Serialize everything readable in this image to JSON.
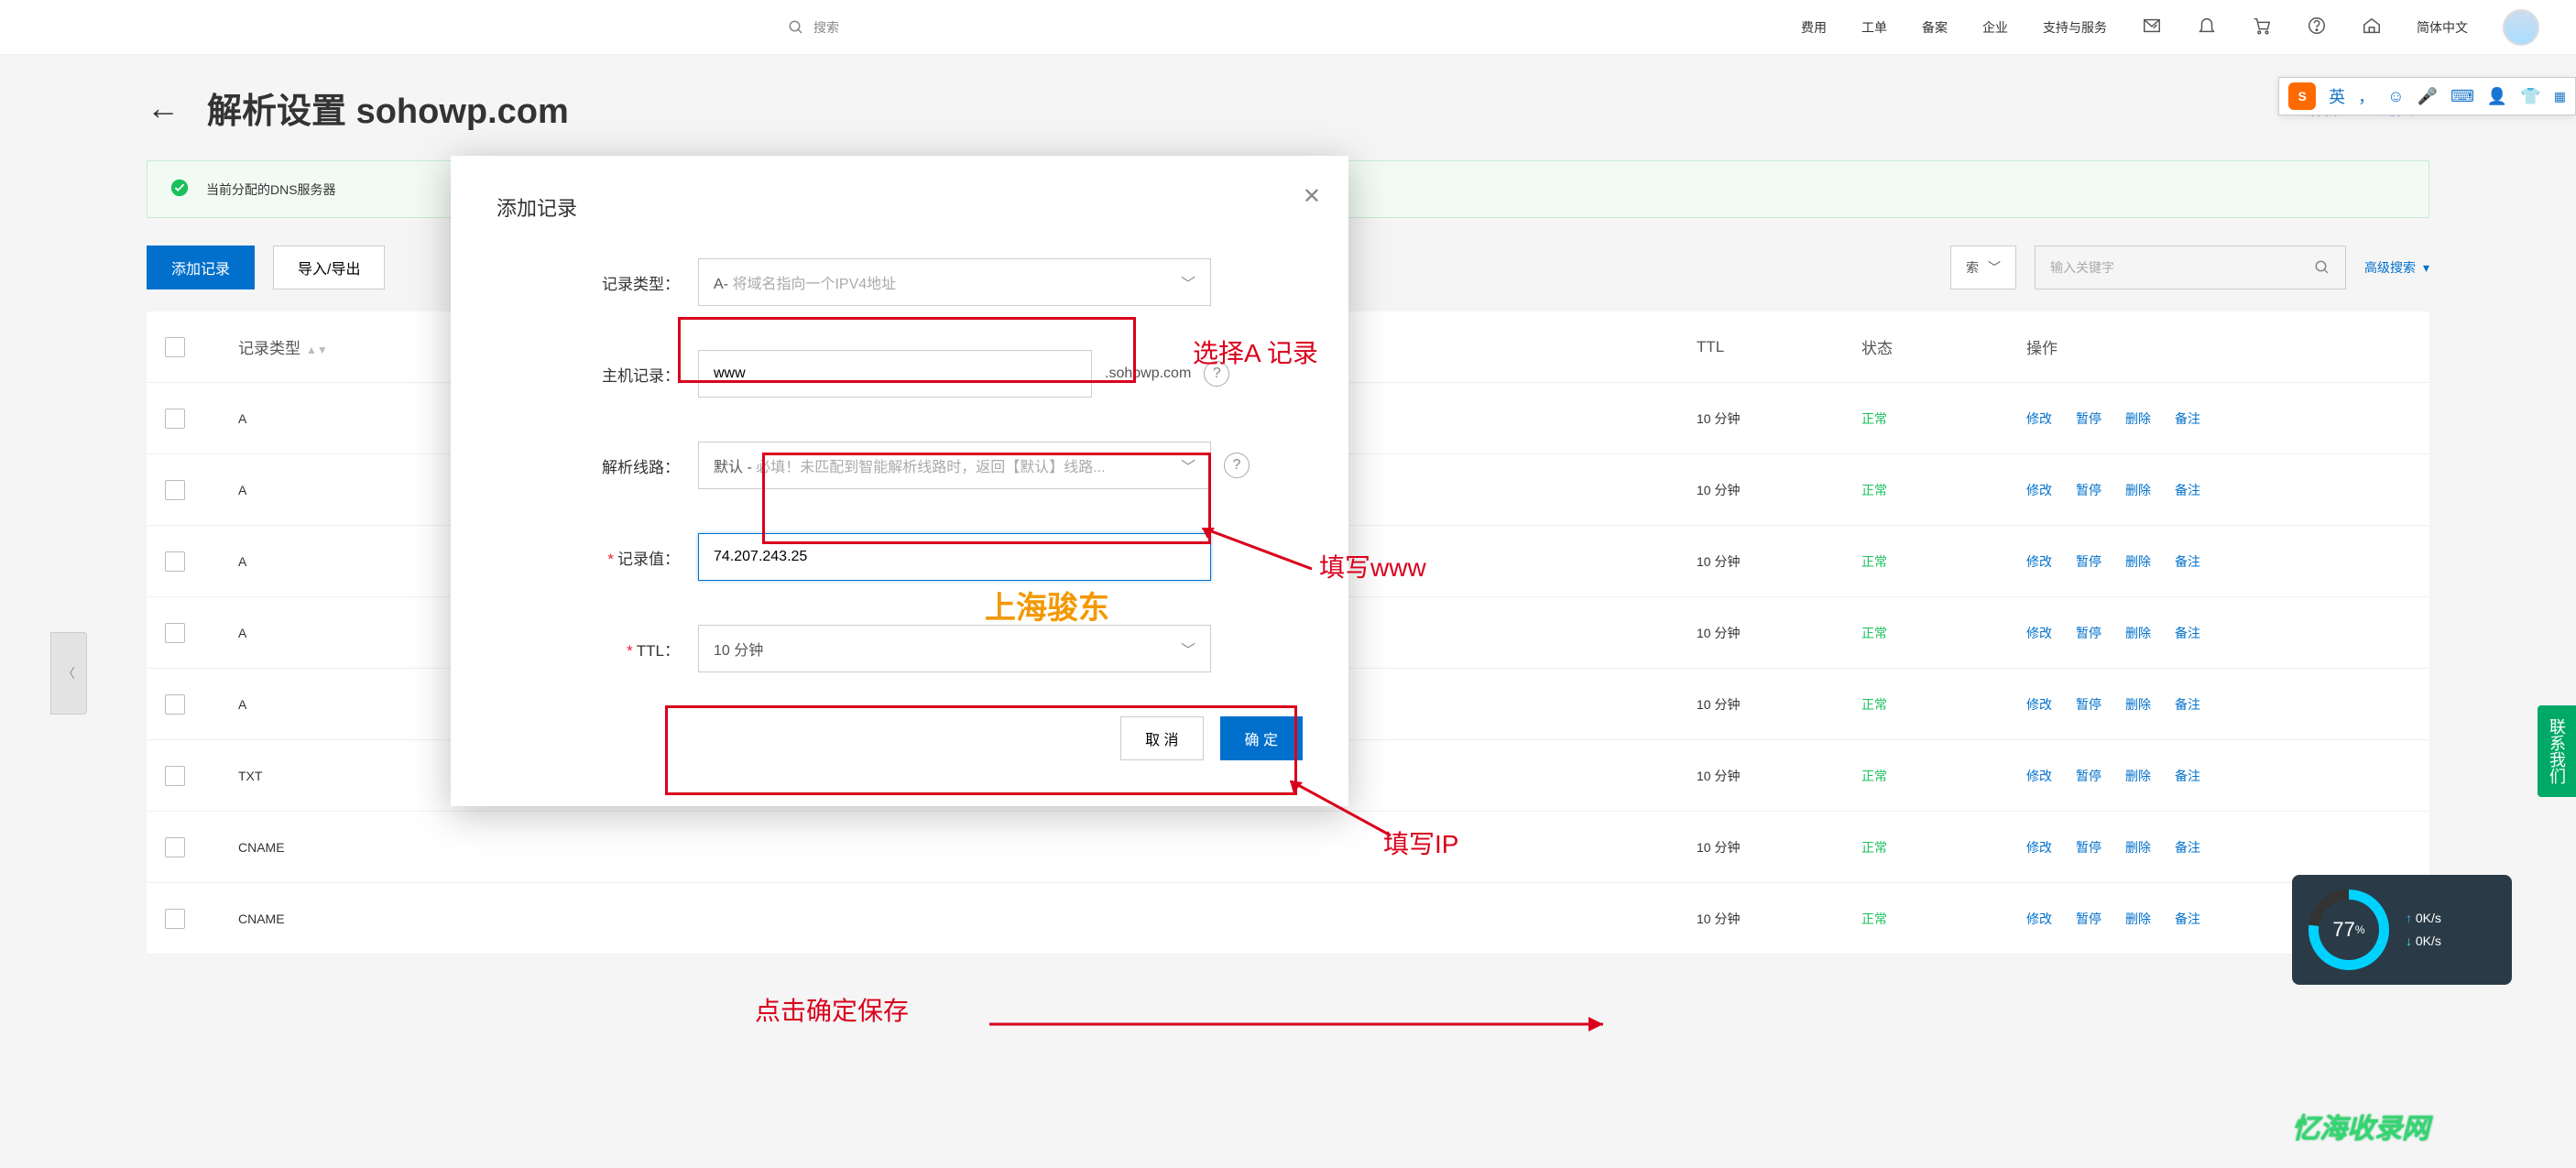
{
  "topnav": {
    "search_placeholder": "搜索",
    "items": [
      "费用",
      "工单",
      "备案",
      "企业",
      "支持与服务"
    ],
    "lang": "简体中文"
  },
  "page": {
    "title_prefix": "解析设置",
    "domain": "sohowp.com",
    "head_right": "云解析DNS\"免费…",
    "alert": "当前分配的DNS服务器"
  },
  "toolbar": {
    "add": "添加记录",
    "import_export": "导入/导出",
    "scope_suffix": "索",
    "keyword_placeholder": "输入关键字",
    "adv_search": "高级搜索"
  },
  "table": {
    "headers": {
      "type": "记录类型",
      "ttl": "TTL",
      "status": "状态",
      "ops": "操作"
    },
    "rows": [
      {
        "type": "A",
        "ttl": "10 分钟",
        "status": "正常"
      },
      {
        "type": "A",
        "ttl": "10 分钟",
        "status": "正常"
      },
      {
        "type": "A",
        "ttl": "10 分钟",
        "status": "正常"
      },
      {
        "type": "A",
        "ttl": "10 分钟",
        "status": "正常"
      },
      {
        "type": "A",
        "ttl": "10 分钟",
        "status": "正常"
      },
      {
        "type": "TXT",
        "ttl": "10 分钟",
        "status": "正常"
      },
      {
        "type": "CNAME",
        "ttl": "10 分钟",
        "status": "正常"
      },
      {
        "type": "CNAME",
        "ttl": "10 分钟",
        "status": "正常"
      }
    ],
    "ops": {
      "modify": "修改",
      "pause": "暂停",
      "delete": "删除",
      "note": "备注"
    }
  },
  "modal": {
    "title": "添加记录",
    "fields": {
      "record_type": {
        "label": "记录类型：",
        "value_prefix": "A- ",
        "value_placeholder": "将域名指向一个IPV4地址"
      },
      "host": {
        "label": "主机记录：",
        "value": "www",
        "suffix": ".sohowp.com"
      },
      "line": {
        "label": "解析线路：",
        "value_prefix": "默认 - ",
        "value_placeholder": "必填！未匹配到智能解析线路时，返回【默认】线路..."
      },
      "value": {
        "label": "记录值：",
        "value": "74.207.243.25"
      },
      "ttl": {
        "label": "TTL：",
        "value": "10 分钟"
      }
    },
    "cancel": "取 消",
    "ok": "确 定"
  },
  "annotations": {
    "select_a": "选择A  记录",
    "fill_www": "填写www",
    "watermark": "上海骏东",
    "fill_ip": "填写IP",
    "click_ok": "点击确定保存",
    "site_wm": "忆海收录网"
  },
  "ime": {
    "logo": "S",
    "lang": "英",
    "punct": "，"
  },
  "perf": {
    "pct": "77",
    "pct_unit": "%",
    "up": "0K/s",
    "dn": "0K/s"
  },
  "contact": "联系我们"
}
